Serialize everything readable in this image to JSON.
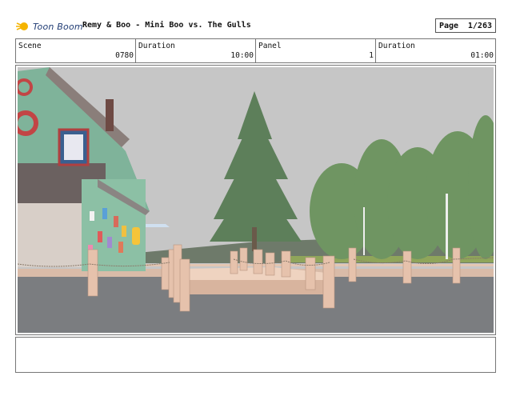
{
  "header": {
    "logo_text": "Toon Boom",
    "title": "Remy & Boo - Mini Boo vs. The Gulls",
    "page_label": "Page",
    "page_value": "1/263"
  },
  "info": {
    "scene_label": "Scene",
    "scene_value": "0780",
    "duration_label": "Duration",
    "duration_value": "10:00",
    "panel_label": "Panel",
    "panel_value": "1",
    "panel_duration_label": "Duration",
    "panel_duration_value": "01:00"
  },
  "colors": {
    "sky": "#c9c9c9",
    "water": "#7d7f81",
    "wood": "#e8c8b4",
    "house": "#7fb59a",
    "trees": "#5f8a5b",
    "frame": "#777777"
  },
  "image_description_icons": [
    "toon-boom-logo-icon"
  ]
}
